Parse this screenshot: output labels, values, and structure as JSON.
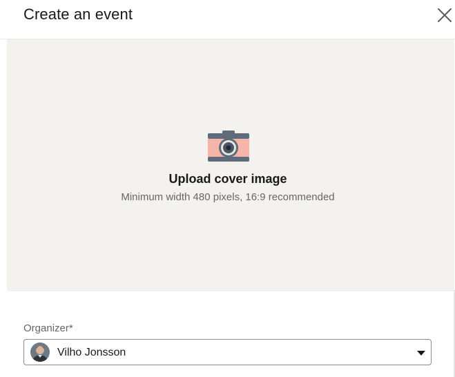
{
  "dialog": {
    "title": "Create an event",
    "close_icon": "close-icon"
  },
  "cover_upload": {
    "icon": "camera-icon",
    "title": "Upload cover image",
    "subtitle": "Minimum width 480 pixels, 16:9 recommended",
    "background_color": "#f3f2ef"
  },
  "organizer": {
    "label": "Organizer*",
    "selected_name": "Vilho Jonsson",
    "avatar_icon": "avatar",
    "caret_icon": "caret-down-icon"
  },
  "colors": {
    "camera_body": "#f5b5a8",
    "camera_dark": "#5e6b7a",
    "text_primary": "#191919",
    "text_secondary": "#666666"
  }
}
